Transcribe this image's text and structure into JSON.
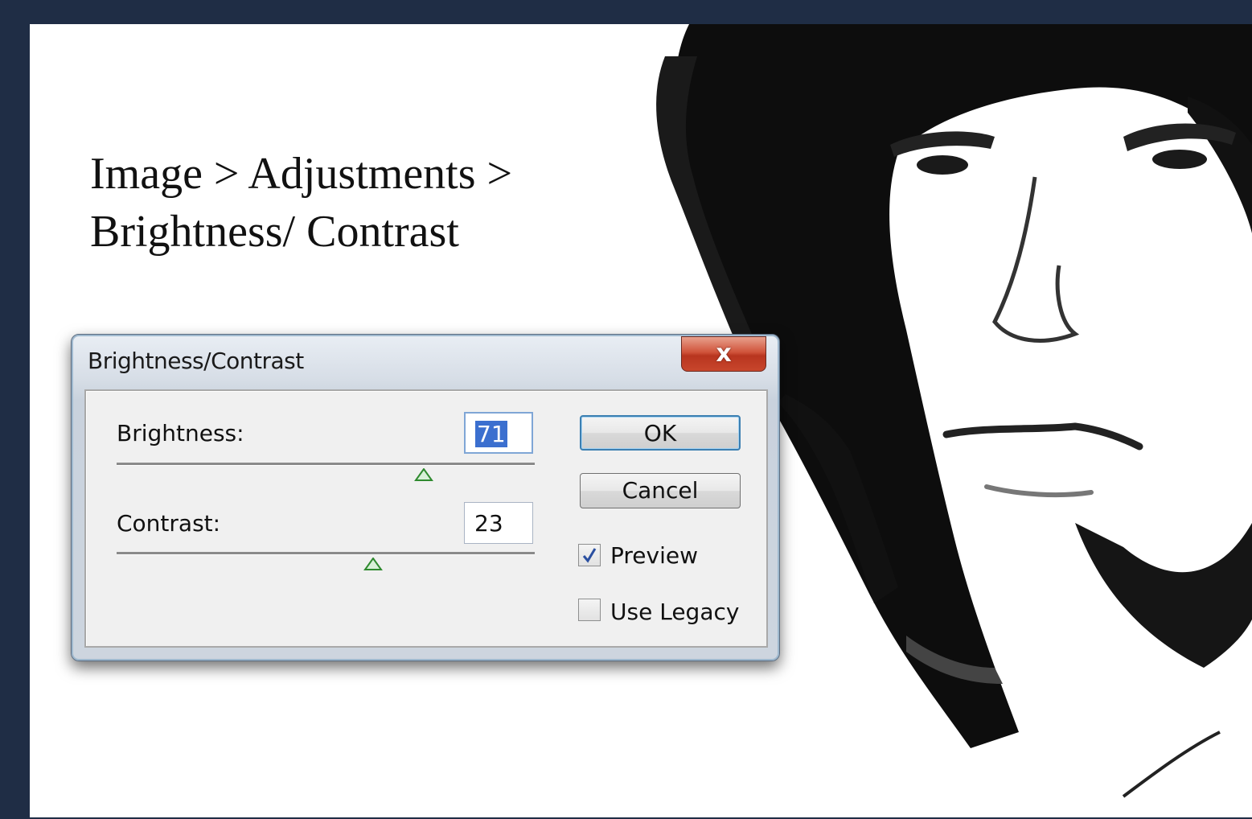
{
  "instruction": {
    "line1": "Image > Adjustments >",
    "line2": "Brightness/ Contrast"
  },
  "dialog": {
    "title": "Brightness/Contrast",
    "close_label": "x",
    "brightness": {
      "label": "Brightness:",
      "value": "71",
      "slider_fraction": 0.74
    },
    "contrast": {
      "label": "Contrast:",
      "value": "23",
      "slider_fraction": 0.61
    },
    "ok_label": "OK",
    "cancel_label": "Cancel",
    "preview": {
      "label": "Preview",
      "checked": true
    },
    "use_legacy": {
      "label": "Use Legacy",
      "checked": false
    }
  },
  "colors": {
    "frame": "#1f2d45",
    "selection": "#3b6fcf",
    "close_button": "#c8462c",
    "slider_thumb": "#4fae4f"
  }
}
